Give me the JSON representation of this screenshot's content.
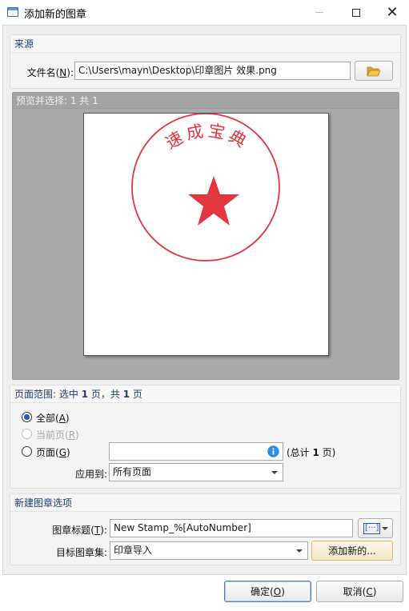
{
  "window": {
    "title": "添加新的图章",
    "minimize": "—",
    "maximize": "☐",
    "close": "✕"
  },
  "source": {
    "header": "来源",
    "file_label": "文件名",
    "file_accel": "N",
    "file_value": "C:\\Users\\mayn\\Desktop\\印章图片 效果.png",
    "browse_icon": "folder-open-icon"
  },
  "preview": {
    "header": "预览并选择: 1 共 1",
    "stamp_text": "速成宝典",
    "stamp_color": "#e0202a"
  },
  "page_range": {
    "header_prefix": "页面范围: 选中 ",
    "header_selected": "1",
    "header_mid": " 页，共 ",
    "header_total": "1",
    "header_suffix": " 页",
    "all_label": "全部",
    "all_accel": "A",
    "current_label": "当前页",
    "current_accel": "R",
    "pages_label": "页面",
    "pages_accel": "G",
    "pages_value": "",
    "pages_total_prefix": "(总计 ",
    "pages_total_value": "1",
    "pages_total_suffix": " 页)",
    "apply_label": "应用到:",
    "apply_value": "所有页面"
  },
  "new_stamp": {
    "header": "新建图章选项",
    "title_label": "图章标题",
    "title_accel": "T",
    "title_value": "New Stamp_%[AutoNumber]",
    "insert_macro_glyph": "[···]",
    "target_label": "目标图章集:",
    "target_value": "印章导入",
    "add_new_label": "添加新的..."
  },
  "footer": {
    "ok_label": "确定",
    "ok_accel": "O",
    "cancel_label": "取消",
    "cancel_accel": "C"
  }
}
